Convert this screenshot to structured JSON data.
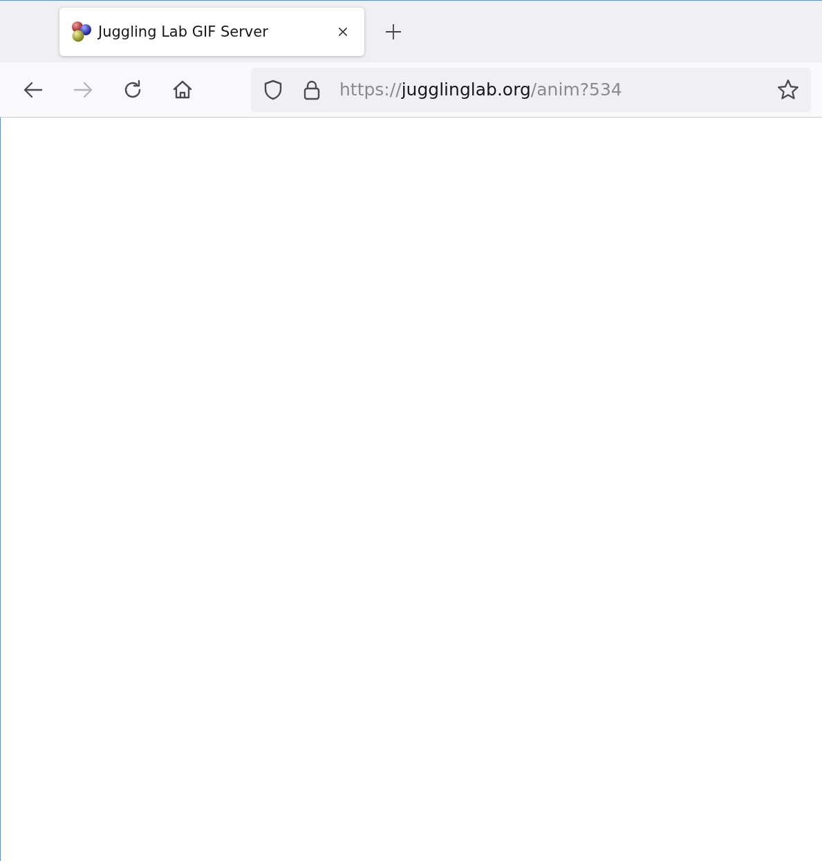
{
  "tabs": [
    {
      "title": "Juggling Lab GIF Server",
      "selected": true
    }
  ],
  "nav_buttons": [
    {
      "kind": "back",
      "disabled": false
    },
    {
      "kind": "forward",
      "disabled": true
    },
    {
      "kind": "reload",
      "disabled": false
    },
    {
      "kind": "home",
      "disabled": false
    }
  ],
  "address_bar": {
    "scheme": "https://",
    "host": "jugglinglab.org",
    "path": "/anim?534"
  }
}
